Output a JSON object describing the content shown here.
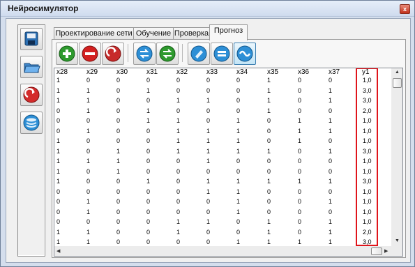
{
  "window": {
    "title": "Нейросимулятор",
    "close_glyph": "x"
  },
  "tabs": [
    {
      "label": "Проектирование сети"
    },
    {
      "label": "Обучение"
    },
    {
      "label": "Проверка"
    },
    {
      "label": "Прогноз",
      "active": true
    }
  ],
  "sidebar": {
    "items": [
      {
        "icon": "save-icon"
      },
      {
        "icon": "open-folder-icon"
      },
      {
        "icon": "redo-icon"
      },
      {
        "icon": "database-icon"
      }
    ]
  },
  "toolbar": {
    "buttons": [
      {
        "icon": "add-icon",
        "color": "#2e9a2e"
      },
      {
        "icon": "remove-icon",
        "color": "#d32121"
      },
      {
        "icon": "redo-icon",
        "color": "#c72a2a"
      },
      {
        "icon": "swap-blue-icon",
        "color": "#2d8fd6"
      },
      {
        "icon": "swap-green-icon",
        "color": "#2e9a2e"
      },
      {
        "icon": "clear-icon",
        "color": "#2d8fd6"
      },
      {
        "icon": "equals-icon",
        "color": "#2d8fd6"
      },
      {
        "icon": "wave-icon",
        "color": "#2d8fd6",
        "selected": true
      }
    ]
  },
  "table": {
    "columns": [
      "x28",
      "x29",
      "x30",
      "x31",
      "x32",
      "x33",
      "x34",
      "x35",
      "x36",
      "x37",
      "y1"
    ],
    "rows": [
      [
        "1",
        "0",
        "0",
        "0",
        "0",
        "0",
        "0",
        "1",
        "0",
        "0",
        "1,0"
      ],
      [
        "1",
        "1",
        "0",
        "1",
        "0",
        "0",
        "0",
        "1",
        "0",
        "1",
        "3,0"
      ],
      [
        "1",
        "1",
        "0",
        "0",
        "1",
        "1",
        "0",
        "1",
        "0",
        "1",
        "3,0"
      ],
      [
        "0",
        "1",
        "0",
        "1",
        "0",
        "0",
        "0",
        "1",
        "0",
        "0",
        "2,0"
      ],
      [
        "0",
        "0",
        "0",
        "1",
        "1",
        "0",
        "1",
        "0",
        "1",
        "1",
        "1,0"
      ],
      [
        "0",
        "1",
        "0",
        "0",
        "1",
        "1",
        "1",
        "0",
        "1",
        "1",
        "1,0"
      ],
      [
        "1",
        "0",
        "0",
        "0",
        "1",
        "1",
        "1",
        "0",
        "1",
        "0",
        "1,0"
      ],
      [
        "1",
        "0",
        "1",
        "0",
        "1",
        "1",
        "1",
        "1",
        "0",
        "1",
        "3,0"
      ],
      [
        "1",
        "1",
        "1",
        "0",
        "0",
        "1",
        "0",
        "0",
        "0",
        "0",
        "1,0"
      ],
      [
        "1",
        "0",
        "1",
        "0",
        "0",
        "0",
        "0",
        "0",
        "0",
        "0",
        "1,0"
      ],
      [
        "1",
        "0",
        "0",
        "1",
        "0",
        "1",
        "1",
        "1",
        "1",
        "1",
        "3,0"
      ],
      [
        "0",
        "0",
        "0",
        "0",
        "0",
        "1",
        "1",
        "0",
        "0",
        "0",
        "1,0"
      ],
      [
        "0",
        "1",
        "0",
        "0",
        "0",
        "0",
        "1",
        "0",
        "0",
        "1",
        "1,0"
      ],
      [
        "0",
        "1",
        "0",
        "0",
        "0",
        "0",
        "1",
        "0",
        "0",
        "0",
        "1,0"
      ],
      [
        "0",
        "0",
        "0",
        "0",
        "1",
        "1",
        "0",
        "1",
        "0",
        "1",
        "1,0"
      ],
      [
        "1",
        "1",
        "0",
        "0",
        "1",
        "0",
        "0",
        "1",
        "0",
        "1",
        "2,0"
      ],
      [
        "1",
        "1",
        "0",
        "0",
        "0",
        "0",
        "1",
        "1",
        "1",
        "1",
        "3,0"
      ]
    ]
  },
  "highlight_color": "#e0151b"
}
